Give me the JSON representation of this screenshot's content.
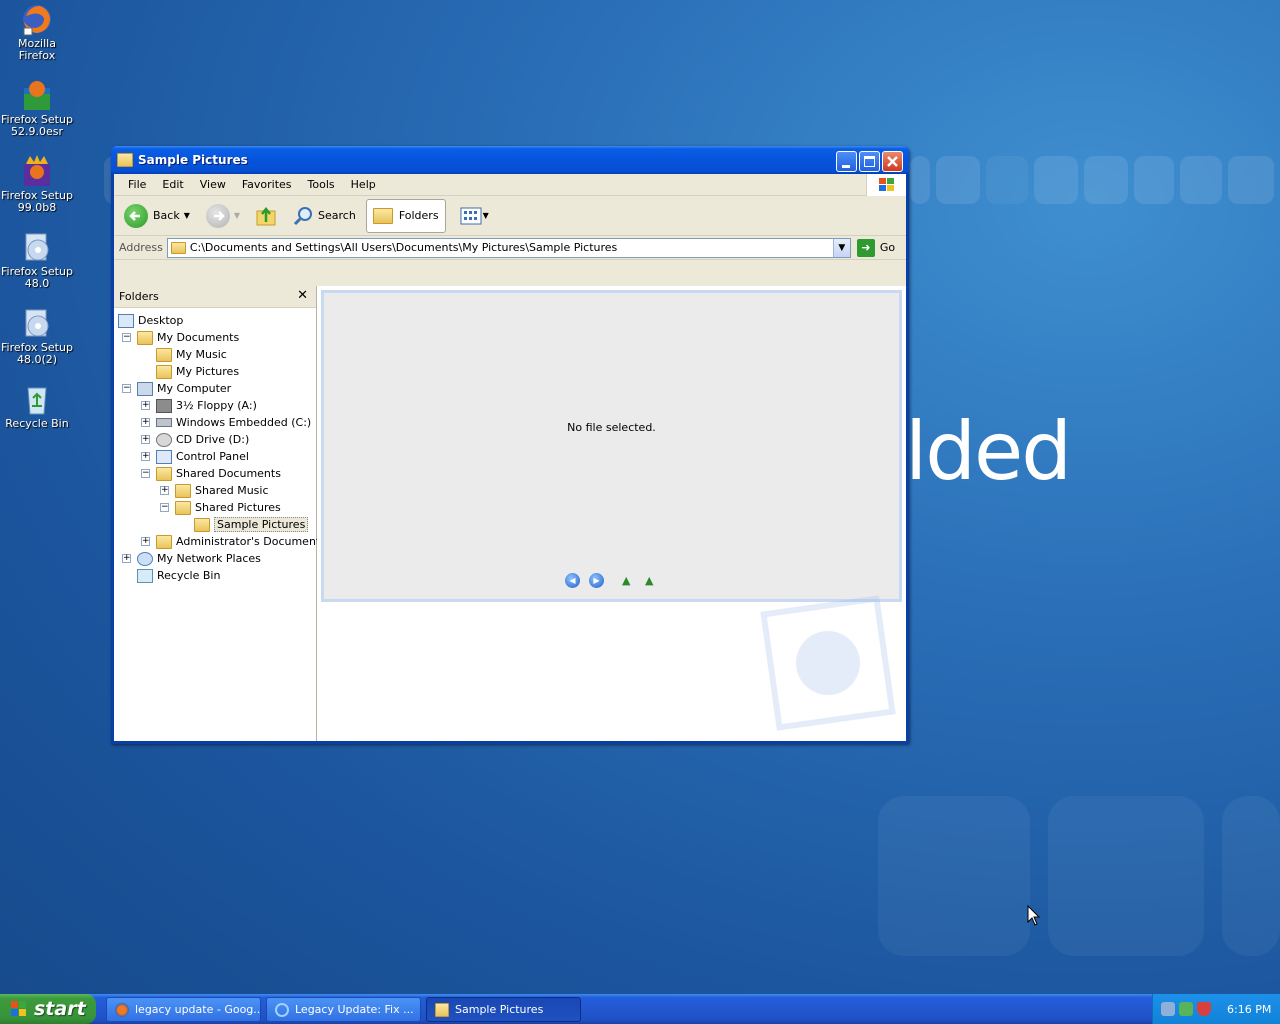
{
  "desktop": {
    "icons": [
      {
        "label": "Mozilla Firefox"
      },
      {
        "label": "Firefox Setup 52.9.0esr"
      },
      {
        "label": "Firefox Setup 99.0b8"
      },
      {
        "label": "Firefox Setup 48.0"
      },
      {
        "label": "Firefox Setup 48.0(2)"
      },
      {
        "label": "Recycle Bin"
      }
    ],
    "wallpaper_text": "lded"
  },
  "window": {
    "title": "Sample Pictures",
    "menu": [
      "File",
      "Edit",
      "View",
      "Favorites",
      "Tools",
      "Help"
    ],
    "toolbar": {
      "back_label": "Back",
      "search_label": "Search",
      "folders_label": "Folders"
    },
    "address": {
      "label": "Address",
      "value": "C:\\Documents and Settings\\All Users\\Documents\\My Pictures\\Sample Pictures",
      "go_label": "Go"
    },
    "folders_pane": {
      "title": "Folders",
      "close_glyph": "✕",
      "tree": [
        {
          "label": "Desktop"
        },
        {
          "label": "My Documents"
        },
        {
          "label": "My Music"
        },
        {
          "label": "My Pictures"
        },
        {
          "label": "My Computer"
        },
        {
          "label": "3½ Floppy (A:)"
        },
        {
          "label": "Windows Embedded (C:)"
        },
        {
          "label": "CD Drive (D:)"
        },
        {
          "label": "Control Panel"
        },
        {
          "label": "Shared Documents"
        },
        {
          "label": "Shared Music"
        },
        {
          "label": "Shared Pictures"
        },
        {
          "label": "Sample Pictures"
        },
        {
          "label": "Administrator's Documents"
        },
        {
          "label": "My Network Places"
        },
        {
          "label": "Recycle Bin"
        }
      ]
    },
    "preview": {
      "message": "No file selected."
    }
  },
  "taskbar": {
    "start_label": "start",
    "tasks": [
      {
        "label": "legacy update - Goog..."
      },
      {
        "label": "Legacy Update: Fix ..."
      },
      {
        "label": "Sample Pictures"
      }
    ],
    "clock": "6:16 PM"
  },
  "colors": {
    "titlebar": "#0654dc",
    "start_button": "#3c9b3c",
    "taskbar": "#2257d0",
    "tray": "#1082d8"
  }
}
